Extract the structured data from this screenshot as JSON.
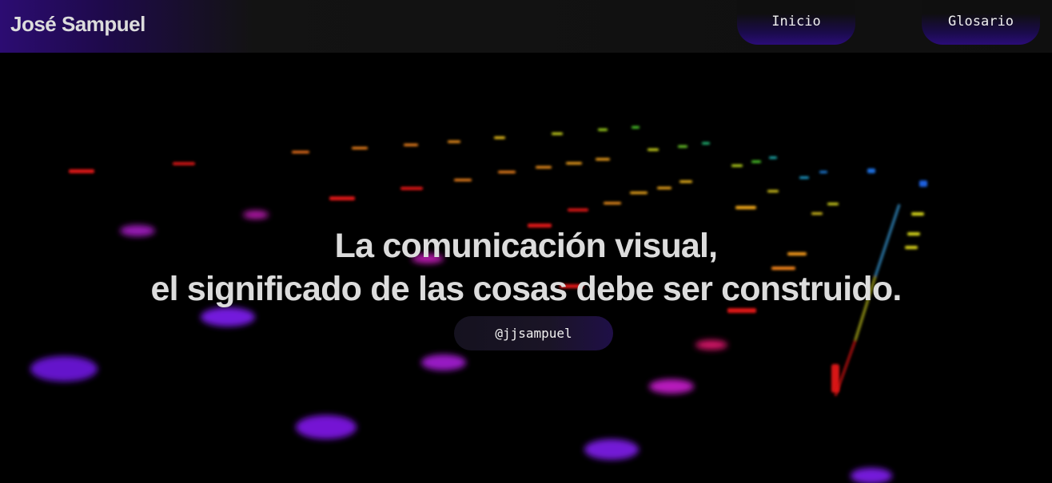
{
  "header": {
    "brand": "José Sampuel",
    "nav": [
      {
        "label": "Inicio"
      },
      {
        "label": "Glosario"
      }
    ]
  },
  "hero": {
    "title_line1": "La comunicación visual,",
    "title_line2": "el significado de las cosas debe ser construido.",
    "handle": "@jjsampuel"
  },
  "colors": {
    "accent": "#2a0c78",
    "header_bg": "#0f0f0f",
    "text": "#dcdcdc"
  }
}
